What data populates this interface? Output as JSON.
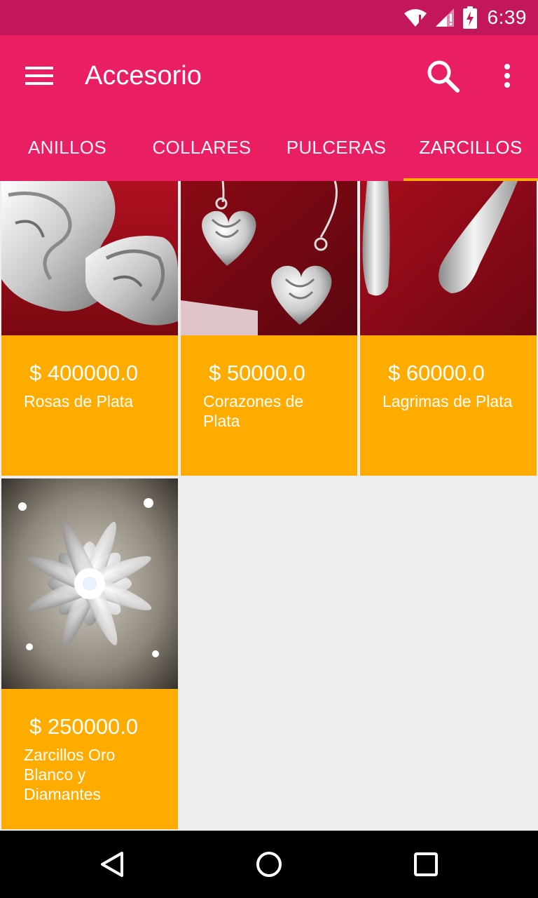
{
  "status_bar": {
    "time": "6:39",
    "icons": [
      "wifi-icon",
      "signal-icon",
      "battery-charging-icon"
    ]
  },
  "app_bar": {
    "title": "Accesorio",
    "icons": {
      "menu": "hamburger-menu-icon",
      "search": "search-icon",
      "overflow": "more-vert-icon"
    },
    "background": "#e91e63"
  },
  "tabs": [
    {
      "label": "ANILLOS",
      "active": false
    },
    {
      "label": "COLLARES",
      "active": false
    },
    {
      "label": "PULCERAS",
      "active": false
    },
    {
      "label": "ZARCILLOS",
      "active": true
    }
  ],
  "products": [
    {
      "price": "$ 400000.0",
      "name": "Rosas de Plata"
    },
    {
      "price": "$ 50000.0",
      "name": "Corazones de Plata"
    },
    {
      "price": "$ 60000.0",
      "name": "Lagrimas de Plata"
    },
    {
      "price": "$ 250000.0",
      "name": "Zarcillos Oro Blanco y Diamantes"
    }
  ],
  "colors": {
    "status_bar": "#c2185b",
    "accent": "#ffab00",
    "card": "#ffab00",
    "background": "#eeeeee"
  },
  "nav_bar": {
    "icons": [
      "back-icon",
      "home-icon",
      "recents-icon"
    ]
  }
}
